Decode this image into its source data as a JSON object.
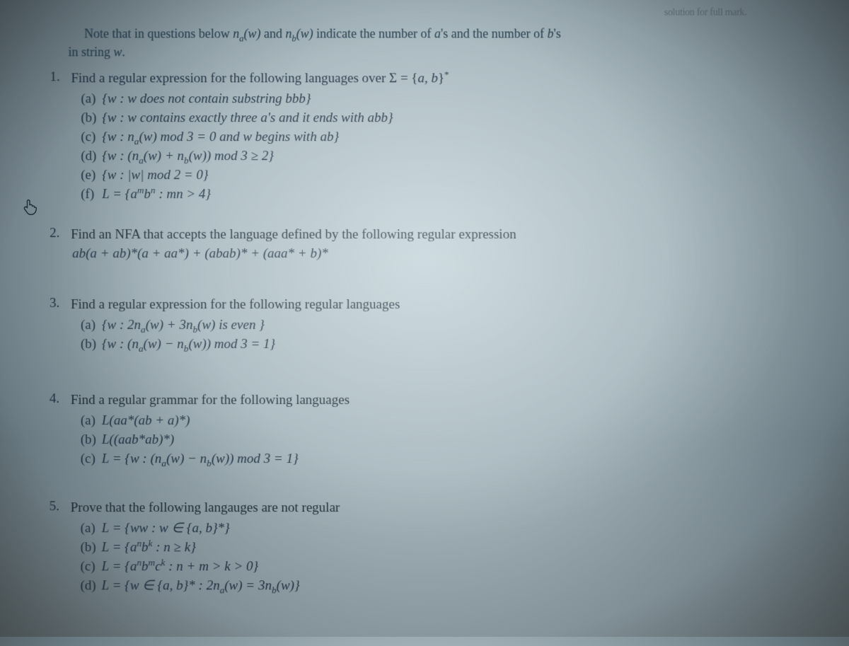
{
  "header_fragment": "solution for full mark.",
  "intro_pre": "Note that in questions below ",
  "intro_mid": " and ",
  "intro_post": " indicate the number of ",
  "intro_a": "a",
  "intro_as": "'s and the number of ",
  "intro_b": "b",
  "intro_bs": "'s",
  "intro_line2": "in string ",
  "intro_w": "w",
  "intro_period": ".",
  "na_w": "n",
  "nb_w": "n",
  "sub_a": "a",
  "sub_b": "b",
  "arg_w": "(w)",
  "q1": {
    "prompt_pre": "Find a regular expression for the following languages over Σ = {",
    "prompt_ab": "a, b",
    "prompt_post": "}",
    "star": "*",
    "a": "{w : w does not contain substring bbb}",
    "b": "{w : w contains exactly three a's and it ends with abb}",
    "c_pre": "{w : n",
    "c_mid1": "(w) mod 3 = 0 and w begins with ab}",
    "d_pre": "{w : (n",
    "d_mid1": "(w) + n",
    "d_mid2": "(w)) mod 3 ≥ 2}",
    "e": "{w : |w| mod 2 = 0}",
    "f_pre": "L = {a",
    "f_m": "m",
    "f_bn": "b",
    "f_n": "n",
    "f_post": " : mn > 4}"
  },
  "q2": {
    "prompt": "Find an NFA that accepts the language defined by the following regular expression",
    "expr": "ab(a + ab)*(a + aa*) + (abab)* + (aaa* + b)*"
  },
  "q3": {
    "prompt": "Find a regular expression for the following regular languages",
    "a_pre": "{w : 2n",
    "a_mid1": "(w) + 3n",
    "a_mid2": "(w) is even }",
    "b_pre": "{w : (n",
    "b_mid1": "(w) − n",
    "b_mid2": "(w)) mod 3 = 1}"
  },
  "q4": {
    "prompt": "Find a regular grammar for the following languages",
    "a": "L(aa*(ab + a)*)",
    "b": "L((aab*ab)*)",
    "c_pre": "L = {w : (n",
    "c_mid1": "(w) − n",
    "c_mid2": "(w)) mod 3 = 1}"
  },
  "q5": {
    "prompt": "Prove that the following langauges are not regular",
    "a": "L = {ww : w ∈ {a, b}*}",
    "b_pre": "L = {a",
    "b_n": "n",
    "b_bk": "b",
    "b_k": "k",
    "b_post": " : n ≥ k}",
    "c_pre": "L = {a",
    "c_n": "n",
    "c_bm": "b",
    "c_m": "m",
    "c_ck": "c",
    "c_k": "k",
    "c_post": " : n + m > k > 0}",
    "d_pre": "L = {w ∈ {a, b}* : 2n",
    "d_mid1": "(w) = 3n",
    "d_mid2": "(w)}"
  }
}
